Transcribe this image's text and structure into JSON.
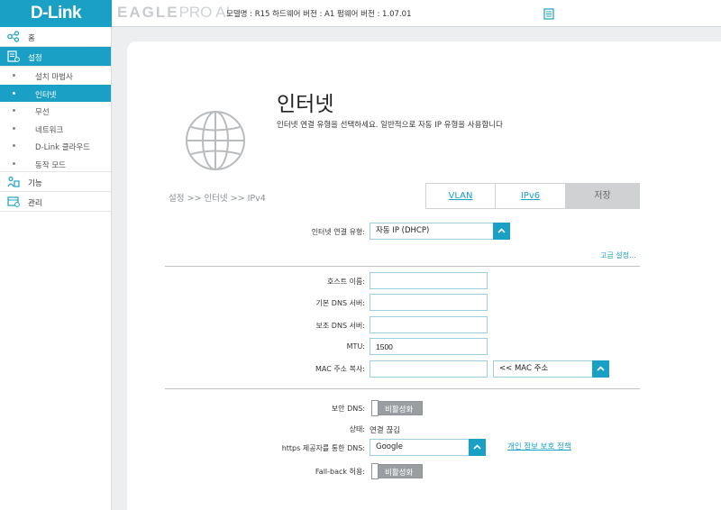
{
  "header": {
    "logo": "D-Link",
    "product_name": "EAGLE",
    "product_suffix": "PRO AI",
    "firmware_info": "모델명 : R15 하드웨어 버전 : A1 펌웨어 버전 : 1.07.01"
  },
  "sidebar": {
    "home": "홈",
    "settings": "설정",
    "sub_items": [
      "설치 마법사",
      "인터넷",
      "무선",
      "네트워크",
      "D-Link 클라우드",
      "동작 모드"
    ],
    "features": "기능",
    "management": "관리"
  },
  "page": {
    "title": "인터넷",
    "description": "인터넷 연결 유형을 선택하세요. 일반적으로 자동 IP 유형을 사용합니다",
    "breadcrumb": "설정 >> 인터넷 >> IPv4"
  },
  "tabs": {
    "vlan": "VLAN",
    "ipv6": "IPv6",
    "save": "저장"
  },
  "form": {
    "connection_type_label": "인터넷 연결 유형:",
    "connection_type_value": "자동 IP (DHCP)",
    "advanced_link": "고급 설정...",
    "hostname_label": "호스트 이름:",
    "hostname_value": "",
    "primary_dns_label": "기본 DNS 서버:",
    "primary_dns_value": "",
    "secondary_dns_label": "보조 DNS 서버:",
    "secondary_dns_value": "",
    "mtu_label": "MTU:",
    "mtu_value": "1500",
    "mac_clone_label": "MAC 주소 복사:",
    "mac_clone_value": "",
    "mac_select_value": "<< MAC 주소",
    "secure_dns_label": "보안 DNS:",
    "secure_dns_toggle": "비활성화",
    "status_label": "상태:",
    "status_value": "연결 끊김",
    "https_dns_label": "https 제공자를 통한 DNS:",
    "https_dns_value": "Google",
    "privacy_link": "개인 정보 보호 정책",
    "fallback_label": "Fall-back 허용:",
    "fallback_toggle": "비활성화"
  },
  "colors": {
    "accent": "#1aa0c4",
    "toggle_off": "#9a9ea2"
  }
}
